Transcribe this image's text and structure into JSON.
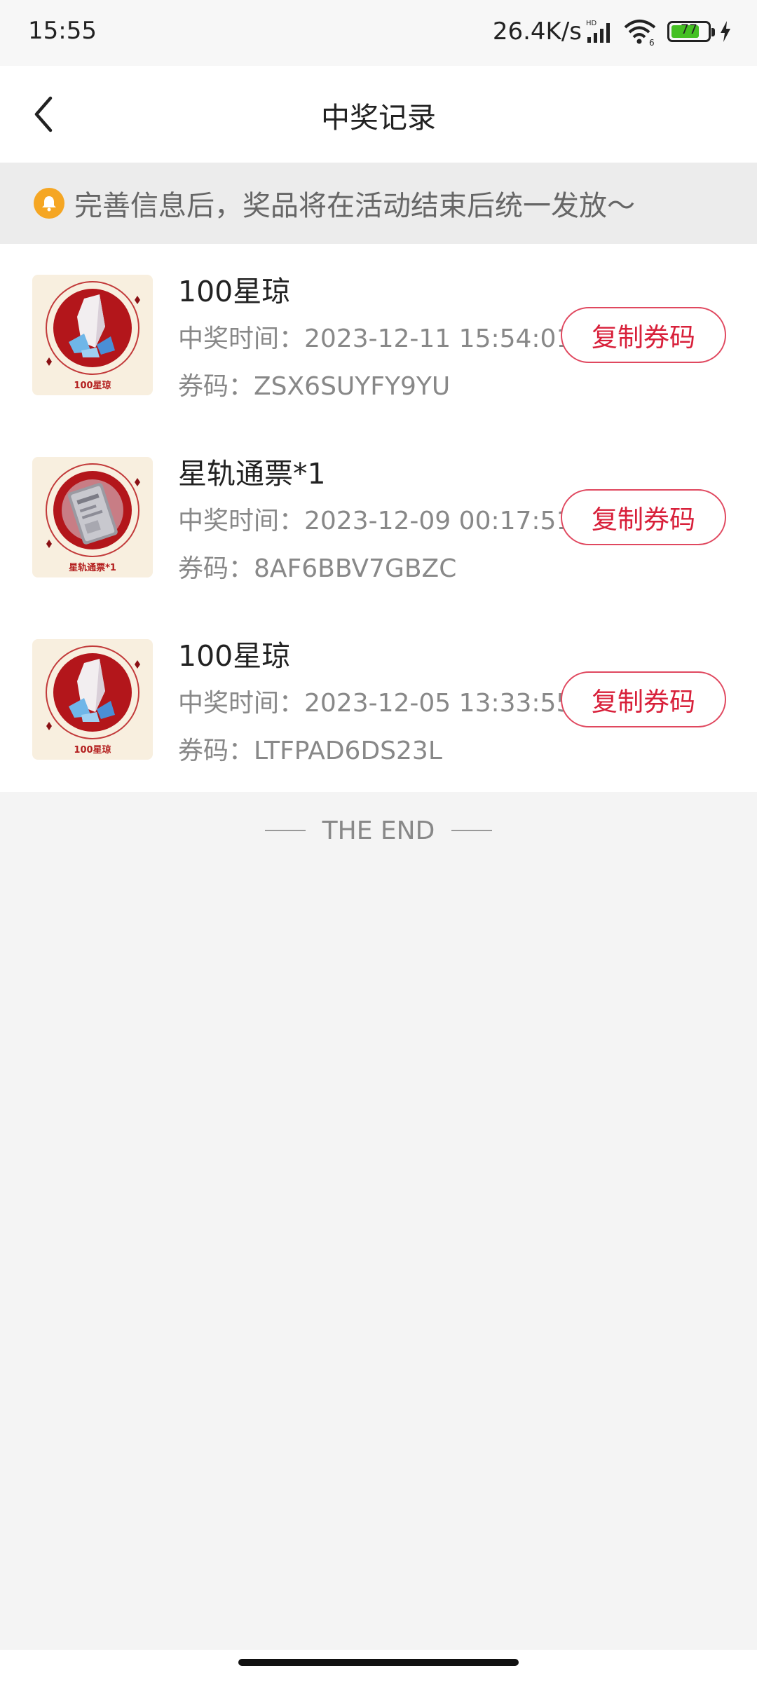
{
  "status_bar": {
    "time": "15:55",
    "net_speed": "26.4K/s",
    "battery_level": "77",
    "battery_fraction": 0.77
  },
  "nav": {
    "title": "中奖记录"
  },
  "notice": {
    "text": "完善信息后，奖品将在活动结束后统一发放～"
  },
  "records": [
    {
      "name": "100星琼",
      "time": "中奖时间：2023-12-11 15:54:01",
      "code": "券码：ZSX6SUYFY9YU",
      "thumb_caption": "100星琼",
      "thumb_icon": "crystal-icon",
      "button_label": "复制券码"
    },
    {
      "name": "星轨通票*1",
      "time": "中奖时间：2023-12-09 00:17:51",
      "code": "券码：8AF6BBV7GBZC",
      "thumb_caption": "星轨通票*1",
      "thumb_icon": "ticket-icon",
      "button_label": "复制券码"
    },
    {
      "name": "100星琼",
      "time": "中奖时间：2023-12-05 13:33:55",
      "code": "券码：LTFPAD6DS23L",
      "thumb_caption": "100星琼",
      "thumb_icon": "crystal-icon",
      "button_label": "复制券码"
    }
  ],
  "footer": {
    "end_text": "THE END"
  },
  "colors": {
    "accent": "#d8203a",
    "bell": "#f5a623",
    "battery": "#44c022"
  }
}
